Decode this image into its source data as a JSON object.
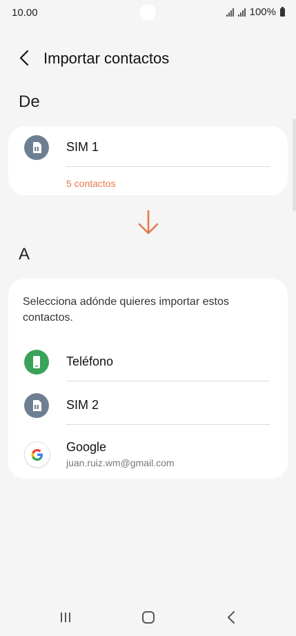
{
  "status_bar": {
    "time": "10.00",
    "battery_text": "100%"
  },
  "header": {
    "title": "Importar contactos",
    "back_icon": "chevron-left-icon"
  },
  "from_section": {
    "label": "De",
    "source": {
      "name": "SIM 1",
      "count_text": "5 contactos",
      "icon": "sim-card-icon"
    }
  },
  "arrow_icon": "arrow-down-icon",
  "to_section": {
    "label": "A",
    "description": "Selecciona adónde quieres importar estos contactos.",
    "options": [
      {
        "name": "Teléfono",
        "sub": "",
        "icon": "phone-icon"
      },
      {
        "name": "SIM 2",
        "sub": "",
        "icon": "sim-card-icon"
      },
      {
        "name": "Google",
        "sub": "juan.ruiz.wm@gmail.com",
        "icon": "google-icon"
      }
    ]
  },
  "colors": {
    "accent": "#e6784a",
    "sim_icon_bg": "#6f7f93",
    "phone_icon_bg": "#3aa25a"
  },
  "nav_bar": {
    "recents_icon": "recents-icon",
    "home_icon": "home-icon",
    "back_icon": "back-icon"
  }
}
